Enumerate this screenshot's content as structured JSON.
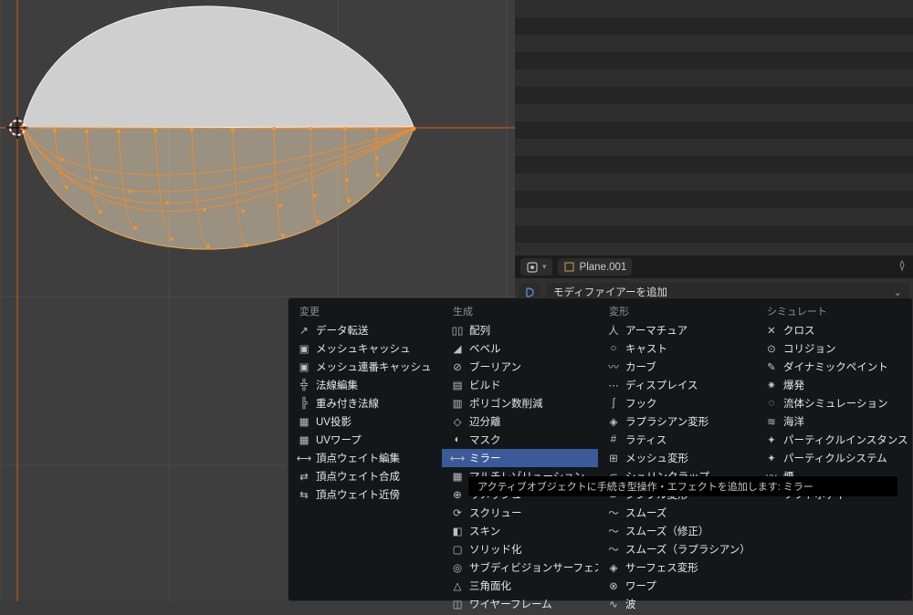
{
  "object": {
    "name": "Plane.001"
  },
  "add_modifier": {
    "label": "モディファイアーを追加"
  },
  "tooltip": "アクティブオブジェクトに手続き型操作・エフェクトを追加します: ミラー",
  "menu": {
    "headers": {
      "change": "変更",
      "generate": "生成",
      "deform": "変形",
      "simulate": "シミュレート"
    },
    "change": [
      {
        "label": "データ転送"
      },
      {
        "label": "メッシュキャッシュ"
      },
      {
        "label": "メッシュ連番キャッシュ"
      },
      {
        "label": "法線編集"
      },
      {
        "label": "重み付き法線"
      },
      {
        "label": "UV投影"
      },
      {
        "label": "UVワープ"
      },
      {
        "label": "頂点ウェイト編集"
      },
      {
        "label": "頂点ウェイト合成"
      },
      {
        "label": "頂点ウェイト近傍"
      }
    ],
    "generate": [
      {
        "label": "配列"
      },
      {
        "label": "ベベル"
      },
      {
        "label": "ブーリアン"
      },
      {
        "label": "ビルド"
      },
      {
        "label": "ポリゴン数削減"
      },
      {
        "label": "辺分離"
      },
      {
        "label": "マスク"
      },
      {
        "label": "ミラー",
        "selected": true
      },
      {
        "label": "マルチレゾリューション"
      },
      {
        "label": "リメッシュ"
      },
      {
        "label": "スクリュー"
      },
      {
        "label": "スキン"
      },
      {
        "label": "ソリッド化"
      },
      {
        "label": "サブディビジョンサーフェス"
      },
      {
        "label": "三角面化"
      },
      {
        "label": "ワイヤーフレーム"
      }
    ],
    "deform": [
      {
        "label": "アーマチュア"
      },
      {
        "label": "キャスト"
      },
      {
        "label": "カーブ"
      },
      {
        "label": "ディスプレイス"
      },
      {
        "label": "フック"
      },
      {
        "label": "ラプラシアン変形"
      },
      {
        "label": "ラティス"
      },
      {
        "label": "メッシュ変形"
      },
      {
        "label": "シュリンクラップ"
      },
      {
        "label": "シンプル変形"
      },
      {
        "label": "スムーズ"
      },
      {
        "label": "スムーズ（修正）"
      },
      {
        "label": "スムーズ（ラプラシアン）"
      },
      {
        "label": "サーフェス変形"
      },
      {
        "label": "ワープ"
      },
      {
        "label": "波"
      }
    ],
    "simulate": [
      {
        "label": "クロス"
      },
      {
        "label": "コリジョン"
      },
      {
        "label": "ダイナミックペイント"
      },
      {
        "label": "爆発"
      },
      {
        "label": "流体シミュレーション"
      },
      {
        "label": "海洋"
      },
      {
        "label": "パーティクルインスタンス"
      },
      {
        "label": "パーティクルシステム"
      },
      {
        "label": "煙"
      },
      {
        "label": "ソフトボディ"
      }
    ]
  },
  "icons": {
    "change": [
      "↗",
      "▣",
      "▣",
      "╬",
      "╠",
      "▦",
      "▦",
      "⟷",
      "⇄",
      "⇆"
    ],
    "generate": [
      "▯▯",
      "◢",
      "⊘",
      "▤",
      "▥",
      "◇",
      "◐",
      "⟷",
      "▦",
      "⊕",
      "⟳",
      "◧",
      "▢",
      "◎",
      "△",
      "◫"
    ],
    "deform": [
      "人",
      "○",
      "〰",
      "⋯",
      "ʃ",
      "◈",
      "#",
      "⊞",
      "⊂",
      "⊃",
      "〜",
      "〜",
      "〜",
      "◈",
      "⊗",
      "∿"
    ],
    "simulate": [
      "✕",
      "⊙",
      "✎",
      "✷",
      "◌",
      "≋",
      "✦",
      "✦",
      "〰",
      "○"
    ]
  }
}
